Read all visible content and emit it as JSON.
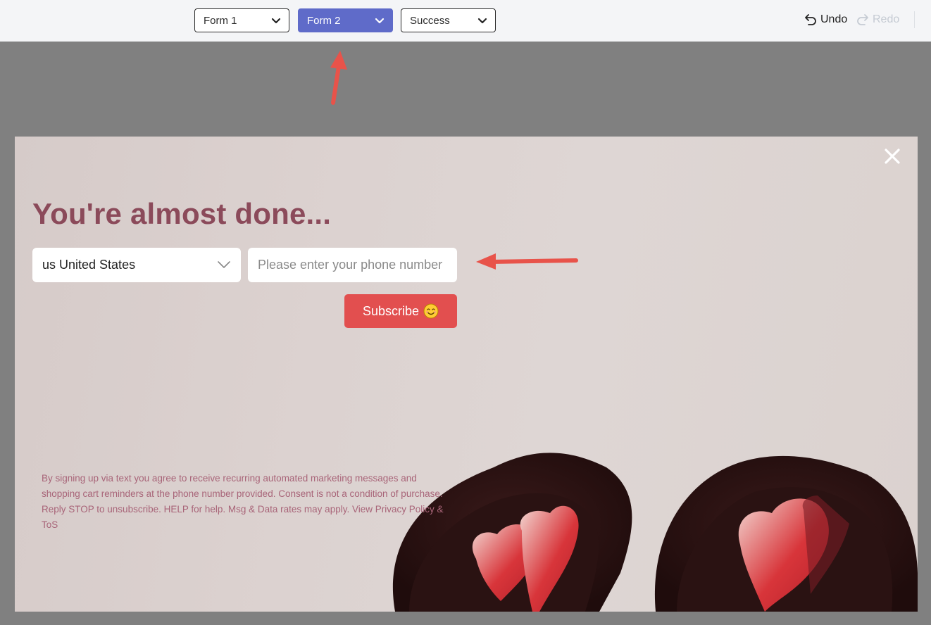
{
  "toolbar": {
    "forms": [
      {
        "label": "Form 1",
        "active": false
      },
      {
        "label": "Form 2",
        "active": true
      },
      {
        "label": "Success",
        "active": false
      }
    ],
    "undo_label": "Undo",
    "redo_label": "Redo"
  },
  "popup": {
    "headline": "You're almost done...",
    "country_selected": "us United States",
    "phone_placeholder": "Please enter your phone number",
    "subscribe_label": "Subscribe",
    "disclaimer": "By signing up via text you agree to receive recurring automated marketing messages and shopping cart reminders at the phone number provided. Consent is not a condition of purchase. Reply STOP to unsubscribe. HELP for help. Msg & Data rates may apply. View Privacy Policy & ToS"
  },
  "colors": {
    "active_tab": "#5f6bc9",
    "headline": "#8b4a5a",
    "subscribe_button": "#e24f4f",
    "disclaimer_text": "#a86478",
    "annotation_arrow": "#e8534a"
  },
  "icons": {
    "dropdown": "chevron-down-icon",
    "undo": "undo-icon",
    "redo": "redo-icon",
    "close": "close-icon",
    "emoji": "smiling-face-emoji"
  }
}
